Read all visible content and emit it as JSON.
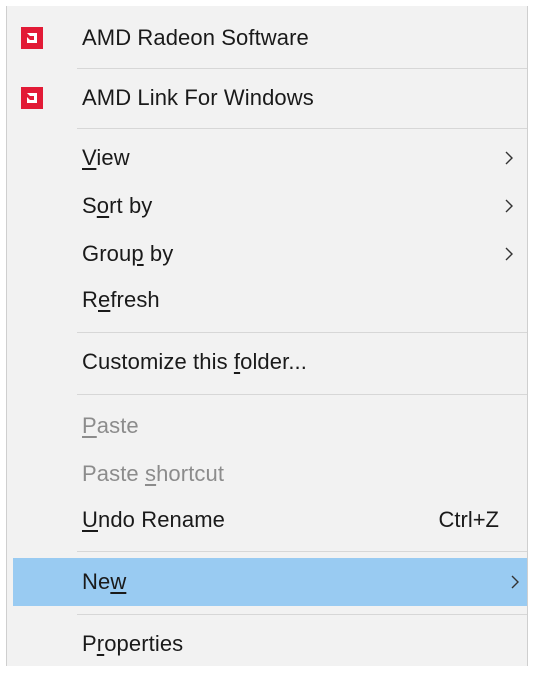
{
  "menu": {
    "items": [
      {
        "label": "AMD Radeon Software",
        "icon": "amd-logo-icon"
      },
      {
        "label": "AMD Link For Windows",
        "icon": "amd-logo-icon"
      },
      {
        "label_pre": "",
        "label_ul": "V",
        "label_post": "iew",
        "submenu": true
      },
      {
        "label_pre": "S",
        "label_ul": "o",
        "label_post": "rt by",
        "submenu": true
      },
      {
        "label_pre": "Grou",
        "label_ul": "p",
        "label_post": " by",
        "submenu": true
      },
      {
        "label_pre": "R",
        "label_ul": "e",
        "label_post": "fresh"
      },
      {
        "label_pre": "Customize this ",
        "label_ul": "f",
        "label_post": "older..."
      },
      {
        "label_pre": "",
        "label_ul": "P",
        "label_post": "aste",
        "disabled": true
      },
      {
        "label_pre": "Paste ",
        "label_ul": "s",
        "label_post": "hortcut",
        "disabled": true
      },
      {
        "label_pre": "",
        "label_ul": "U",
        "label_post": "ndo Rename",
        "shortcut": "Ctrl+Z"
      },
      {
        "label_pre": "Ne",
        "label_ul": "w",
        "label_post": "",
        "submenu": true,
        "highlighted": true
      },
      {
        "label_pre": "P",
        "label_ul": "r",
        "label_post": "operties"
      }
    ]
  },
  "colors": {
    "menu_background": "#f2f2f2",
    "highlight": "#99cbf2",
    "amd_red": "#e21b36",
    "disabled_text": "#8c8c8c"
  }
}
